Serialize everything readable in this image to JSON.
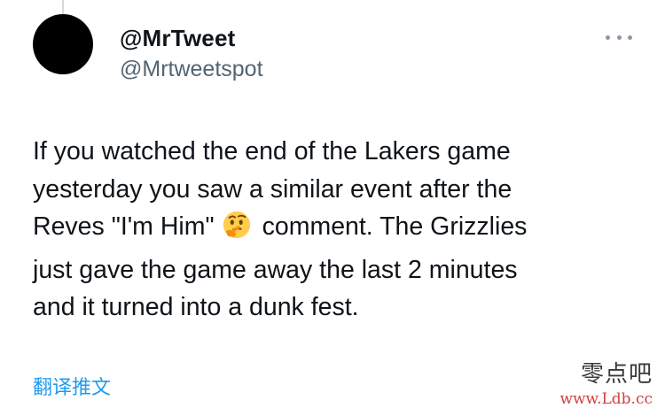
{
  "tweet": {
    "display_name": "@MrTweet",
    "handle": "@Mrtweetspot",
    "more_icon": "more-horizontal-icon",
    "text_lines": [
      "If you watched the end of the Lakers game",
      "yesterday you saw a similar event after the",
      "Reves \"I'm Him\"",
      "comment. The Grizzlies",
      "just gave the game away the last 2 minutes",
      "and it turned into a dunk fest."
    ],
    "emoji_icon": "thinking-face-emoji",
    "translate_label": "翻译推文"
  },
  "watermark": {
    "cn": "零点吧",
    "url": "www.Ldb.cc"
  },
  "colors": {
    "link": "#1d9bf0",
    "handle": "#536471",
    "text": "#0f1419",
    "avatar": "#000000",
    "watermark_url": "#d04040"
  }
}
